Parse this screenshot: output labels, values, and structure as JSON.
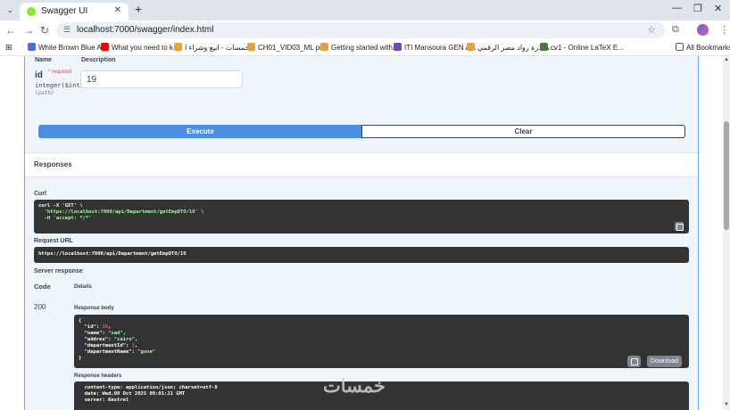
{
  "browser": {
    "tab_title": "Swagger UI",
    "url": "localhost:7000/swagger/index.html",
    "bookmarks": [
      {
        "label": "White Brown Blue A...",
        "color": "#4a6ee0"
      },
      {
        "label": "What you need to k...",
        "color": "#ff0000"
      },
      {
        "label": "خمسات - ابيع وشراء ا...",
        "color": "#f0a030"
      },
      {
        "label": "CH01_VID03_ML pi...",
        "color": "#e8a13a"
      },
      {
        "label": "Getting started with...",
        "color": "#e8a13a"
      },
      {
        "label": "ITI Mansoura GEN A...",
        "color": "#7248b9"
      },
      {
        "label": "مبادرة رواد مصر الرقمي...",
        "color": "#e8a13a"
      },
      {
        "label": "cv1 - Online LaTeX E...",
        "color": "#4a7a3a"
      }
    ],
    "all_bookmarks": "All Bookmarks"
  },
  "parameters": {
    "col_name": "Name",
    "col_description": "Description",
    "param_name": "id",
    "required": "* required",
    "type": "integer($int32)",
    "location": "(path)",
    "value": "19"
  },
  "buttons": {
    "execute": "Execute",
    "clear": "Clear"
  },
  "responses": {
    "title": "Responses",
    "curl_label": "Curl",
    "curl_line1": "curl -X 'GET' \\",
    "curl_line2": "  'https://localhost:7000/api/Department/getEmpDTO/19' \\",
    "curl_line3": "  -H 'accept: */*'",
    "request_url_label": "Request URL",
    "request_url": "https://localhost:7000/api/Department/getEmpDTO/19",
    "server_response_label": "Server response",
    "col_code": "Code",
    "col_details": "Details",
    "status_code": "200",
    "body_label": "Response body",
    "body": {
      "id": "19",
      "name": "\"sad\"",
      "addres": "\"cairo\"",
      "departmentId": "1",
      "departmentName": "\"gone\""
    },
    "download": "Download",
    "headers_label": "Response headers",
    "headers_line1": "content-type: application/json; charset=utf-8",
    "headers_line2": "date: Wed,08 Oct 2025 09:01:21 GMT",
    "headers_line3": "server: Kestrel"
  },
  "watermark": "خمسات"
}
